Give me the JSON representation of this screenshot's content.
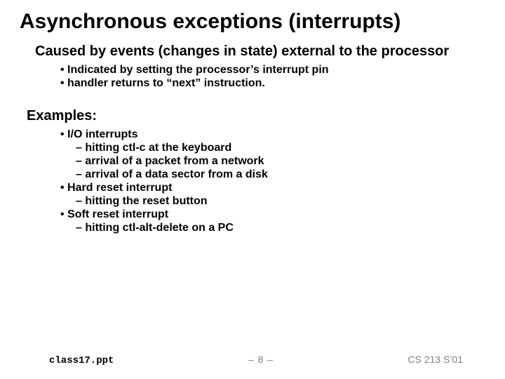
{
  "title": "Asynchronous exceptions (interrupts)",
  "caused": {
    "heading": "Caused by events (changes in state) external to the processor",
    "pts": [
      "Indicated by setting the processor’s interrupt pin",
      "handler returns to “next” instruction."
    ]
  },
  "examples": {
    "heading": "Examples:",
    "items": [
      {
        "label": "I/O interrupts",
        "subs": [
          "hitting ctl-c at the keyboard",
          "arrival of a packet from a network",
          "arrival of a data sector from a disk"
        ]
      },
      {
        "label": "Hard reset interrupt",
        "subs": [
          "hitting the reset button"
        ]
      },
      {
        "label": "Soft reset interrupt",
        "subs": [
          "hitting ctl-alt-delete on a PC"
        ]
      }
    ]
  },
  "footer": {
    "file": "class17.ppt",
    "page": "– 8 –",
    "course": "CS 213 S’01"
  }
}
